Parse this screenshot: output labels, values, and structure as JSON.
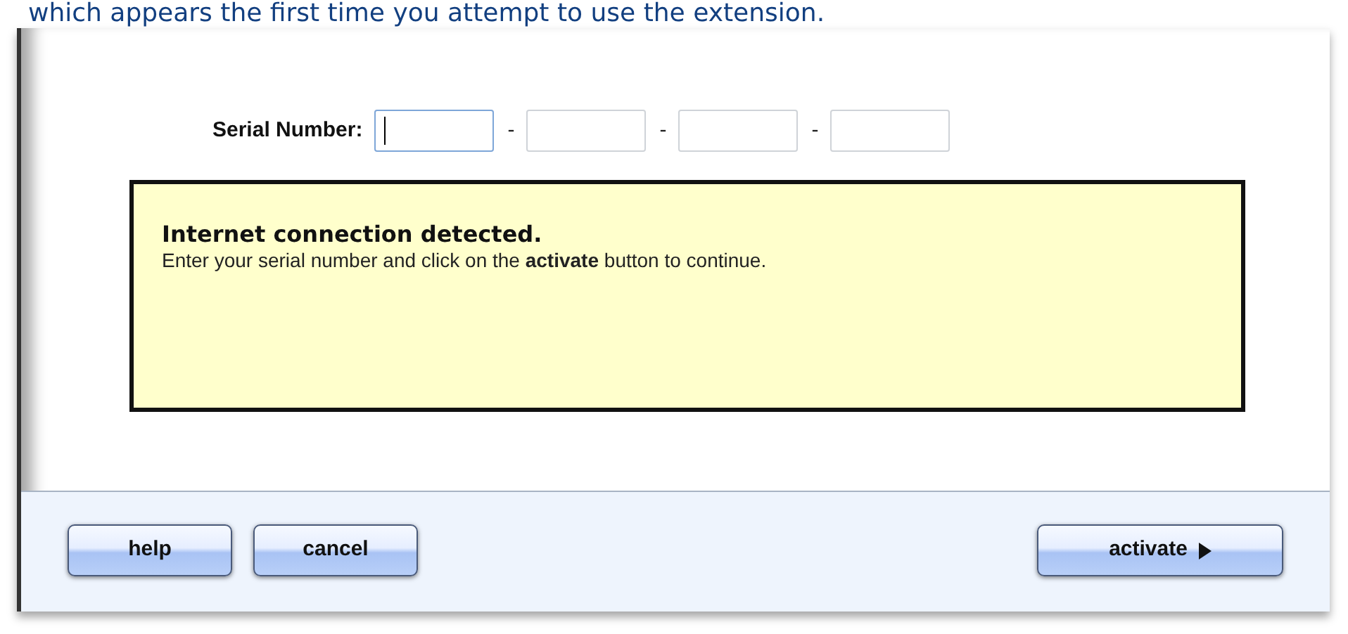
{
  "caption": "which appears the first time you attempt to use the extension.",
  "serial": {
    "label": "Serial Number:",
    "separators": [
      "-",
      "-",
      "-"
    ],
    "fields": [
      {
        "focused": true
      },
      {
        "focused": false
      },
      {
        "focused": false
      },
      {
        "focused": false
      }
    ]
  },
  "message": {
    "title": "Internet connection detected.",
    "body": "Enter your serial number and click on the **activate** button to continue."
  },
  "buttons": [
    {
      "label": "help",
      "kind": "plain"
    },
    {
      "label": "cancel",
      "kind": "plain"
    },
    {
      "label": "activate",
      "kind": "next"
    }
  ]
}
